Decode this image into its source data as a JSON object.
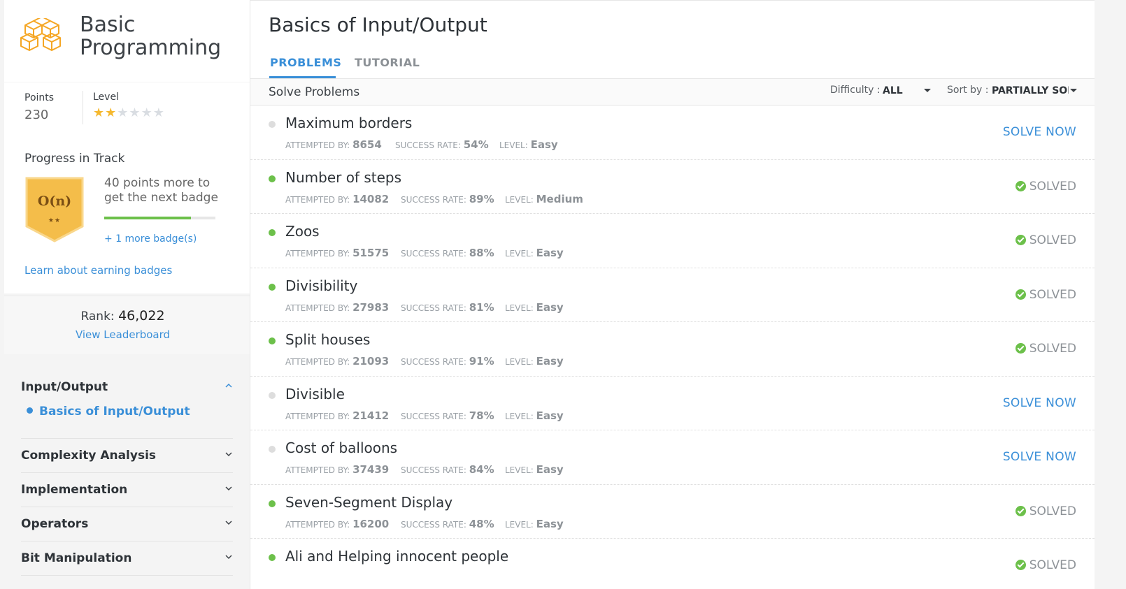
{
  "track": {
    "title_line1": "Basic",
    "title_line2": "Programming"
  },
  "stats": {
    "points_label": "Points",
    "points_value": "230",
    "level_label": "Level",
    "level_stars_filled": 2,
    "level_stars_total": 6
  },
  "progress": {
    "title": "Progress in Track",
    "badge_text": "O(n)",
    "badge_stars": "★★",
    "next_badge_text": "40 points more to get the next badge",
    "progress_fraction": 0.78,
    "more_badges": "+ 1 more badge(s)",
    "learn_link": "Learn about earning badges"
  },
  "rank": {
    "label": "Rank:",
    "value": "46,022",
    "leaderboard_link": "View Leaderboard"
  },
  "topics": [
    {
      "label": "Input/Output",
      "open": true,
      "subtopic": "Basics of Input/Output"
    },
    {
      "label": "Complexity Analysis"
    },
    {
      "label": "Implementation"
    },
    {
      "label": "Operators"
    },
    {
      "label": "Bit Manipulation"
    }
  ],
  "main": {
    "title": "Basics of Input/Output",
    "tabs": [
      {
        "label": "PROBLEMS",
        "active": true
      },
      {
        "label": "TUTORIAL",
        "active": false
      }
    ],
    "solve_problems": "Solve Problems",
    "difficulty_label": "Difficulty :",
    "difficulty_value": "ALL",
    "sort_label": "Sort by :",
    "sort_value": "PARTIALLY SOLVED"
  },
  "meta_labels": {
    "attempted": "Attempted by:",
    "success": "Success rate:",
    "level": "Level:"
  },
  "problems": [
    {
      "name": "Maximum borders",
      "attempted": "8654",
      "success": "54%",
      "level": "Easy",
      "status": "SOLVE NOW",
      "solved": false
    },
    {
      "name": "Number of steps",
      "attempted": "14082",
      "success": "89%",
      "level": "Medium",
      "status": "SOLVED",
      "solved": true
    },
    {
      "name": "Zoos",
      "attempted": "51575",
      "success": "88%",
      "level": "Easy",
      "status": "SOLVED",
      "solved": true
    },
    {
      "name": "Divisibility",
      "attempted": "27983",
      "success": "81%",
      "level": "Easy",
      "status": "SOLVED",
      "solved": true
    },
    {
      "name": "Split houses",
      "attempted": "21093",
      "success": "91%",
      "level": "Easy",
      "status": "SOLVED",
      "solved": true
    },
    {
      "name": "Divisible",
      "attempted": "21412",
      "success": "78%",
      "level": "Easy",
      "status": "SOLVE NOW",
      "solved": false
    },
    {
      "name": "Cost of balloons",
      "attempted": "37439",
      "success": "84%",
      "level": "Easy",
      "status": "SOLVE NOW",
      "solved": false
    },
    {
      "name": "Seven-Segment Display",
      "attempted": "16200",
      "success": "48%",
      "level": "Easy",
      "status": "SOLVED",
      "solved": true
    },
    {
      "name": "Ali and Helping innocent people",
      "attempted": "",
      "success": "",
      "level": "",
      "status": "SOLVED",
      "solved": true
    }
  ]
}
